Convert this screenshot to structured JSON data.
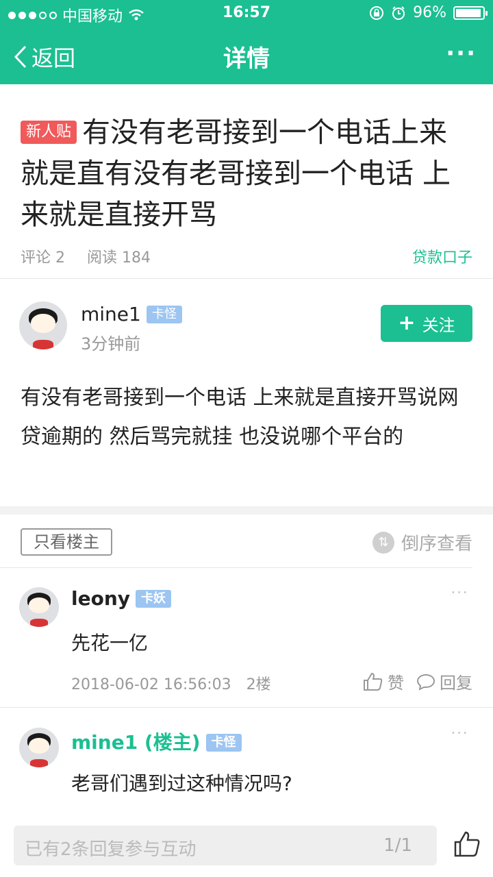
{
  "status": {
    "carrier": "中国移动",
    "time": "16:57",
    "battery": "96%",
    "battery_level": 0.96
  },
  "nav": {
    "back_label": "返回",
    "title": "详情",
    "more": "···"
  },
  "post": {
    "tag": "新人贴",
    "title": "有没有老哥接到一个电话上来就是直有没有老哥接到一个电话 上来就是直接开骂",
    "comments": "评论 2",
    "reads": "阅读 184",
    "category": "贷款口子"
  },
  "author": {
    "name": "mine1",
    "badge": "卡怪",
    "time": "3分钟前",
    "follow_label": "关注",
    "follow_plus": "+"
  },
  "content": "有没有老哥接到一个电话 上来就是直接开骂说网贷逾期的 然后骂完就挂 也没说哪个平台的",
  "filter": {
    "only_op": "只看楼主",
    "reverse": "倒序查看"
  },
  "replies": [
    {
      "name": "leony",
      "badge": "卡妖",
      "text": "先花一亿",
      "datetime": "2018-06-02 16:56:03",
      "floor": "2楼",
      "like_label": "赞",
      "reply_label": "回复",
      "more": "···"
    },
    {
      "name": "mine1 (楼主)",
      "badge": "卡怪",
      "text": "老哥们遇到过这种情况吗?",
      "more": "···"
    }
  ],
  "bottom": {
    "placeholder": "已有2条回复参与互动",
    "page": "1/1"
  },
  "colors": {
    "accent": "#1bbf92",
    "tag_red": "#f05a5a",
    "badge_blue": "#9cc5f1"
  }
}
